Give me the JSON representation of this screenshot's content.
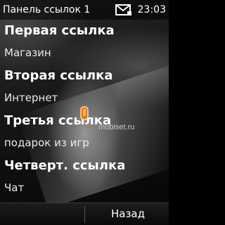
{
  "status_bar": {
    "title": "Панель ссылок 1",
    "time": "23:03",
    "message_icon": "envelope-icon"
  },
  "links": [
    {
      "title": "Первая ссылка",
      "subtitle": "Магазин"
    },
    {
      "title": "Вторая ссылка",
      "subtitle": "Интернет"
    },
    {
      "title": "Третья ссылка",
      "subtitle": "подарок из игр"
    },
    {
      "title": "Четверт. ссылка",
      "subtitle": "Чат"
    }
  ],
  "watermark": "mobiset.ru",
  "softkeys": {
    "right": "Назад"
  },
  "colors": {
    "text": "#ffffff",
    "cursor_accent": "#e07a1a"
  }
}
